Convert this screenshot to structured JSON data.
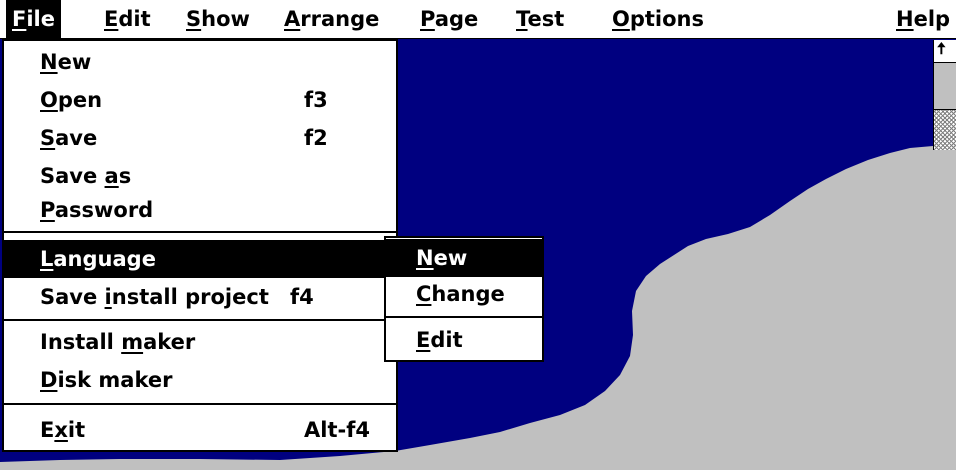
{
  "menubar": {
    "items": [
      {
        "label": "File",
        "accel_char": "F",
        "rest": "ile"
      },
      {
        "label": "Edit",
        "accel_char": "E",
        "rest": "dit"
      },
      {
        "label": "Show",
        "accel_char": "S",
        "rest": "how"
      },
      {
        "label": "Arrange",
        "accel_char": "A",
        "rest": "rrange"
      },
      {
        "label": "Page",
        "accel_char": "P",
        "rest": "age"
      },
      {
        "label": "Test",
        "accel_char": "T",
        "rest": "est"
      },
      {
        "label": "Options",
        "accel_char": "O",
        "rest": "ptions"
      },
      {
        "label": "Help",
        "accel_char": "H",
        "rest": "elp"
      }
    ],
    "active": "File"
  },
  "file_menu": {
    "items": {
      "new": {
        "label": "New",
        "pre": "",
        "u": "N",
        "post": "ew",
        "shortcut": ""
      },
      "open": {
        "label": "Open",
        "pre": "",
        "u": "O",
        "post": "pen",
        "shortcut": "f3"
      },
      "save": {
        "label": "Save",
        "pre": "",
        "u": "S",
        "post": "ave",
        "shortcut": "f2"
      },
      "save_as": {
        "label": "Save as",
        "pre": "Save ",
        "u": "a",
        "post": "s",
        "shortcut": ""
      },
      "password": {
        "label": "Password",
        "pre": "",
        "u": "P",
        "post": "assword",
        "shortcut": ""
      },
      "language": {
        "label": "Language",
        "pre": "",
        "u": "L",
        "post": "anguage",
        "shortcut": ""
      },
      "save_install_project": {
        "label": "Save install project",
        "pre": "Save ",
        "u": "i",
        "post": "nstall project",
        "shortcut": "f4"
      },
      "install_maker": {
        "label": "Install maker",
        "pre": "Install ",
        "u": "m",
        "post": "aker",
        "shortcut": ""
      },
      "disk_maker": {
        "label": "Disk maker",
        "pre": "",
        "u": "D",
        "post": "isk maker",
        "shortcut": ""
      },
      "exit": {
        "label": "Exit",
        "pre": "E",
        "u": "x",
        "post": "it",
        "shortcut": "Alt-f4"
      }
    },
    "highlighted": "Language"
  },
  "language_submenu": {
    "items": {
      "new": {
        "label": "New",
        "pre": "",
        "u": "N",
        "post": "ew"
      },
      "change": {
        "label": "Change",
        "pre": "",
        "u": "C",
        "post": "hange"
      },
      "edit": {
        "label": "Edit",
        "pre": "",
        "u": "E",
        "post": "dit"
      }
    },
    "highlighted": "New"
  },
  "colors": {
    "sky": "#000080",
    "land": "#c0c0c0",
    "menu_bg": "#ffffff",
    "highlight_bg": "#000000",
    "highlight_fg": "#ffffff"
  },
  "icons": {
    "scroll_up": "up-arrow-icon"
  }
}
